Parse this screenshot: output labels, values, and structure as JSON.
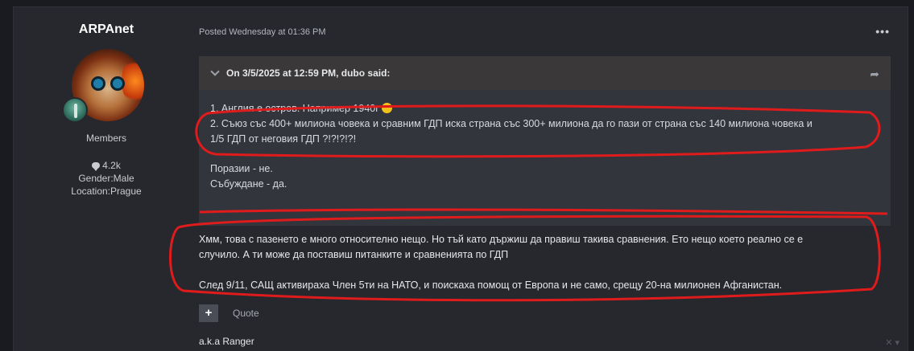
{
  "author": {
    "name": "ARPAnet",
    "group": "Members",
    "post_count": "4.2k",
    "gender": "Gender:Male",
    "location": "Location:Prague"
  },
  "post": {
    "posted": "Posted Wednesday at 01:36 PM",
    "more_label": "•••",
    "quote": {
      "header": "On 3/5/2025 at 12:59 PM, dubo said:",
      "lines": [
        "1. Англия е остров. Например 1940г",
        "2. Съюз със 400+ милиона човека и сравним ГДП иска страна със 300+ милиона да го пази от страна със 140 милиона човека и",
        "1/5 ГДП от неговия ГДП  ?!?!?!?!",
        "Поразии - не.",
        "Събуждане - да."
      ]
    },
    "reply": {
      "lines": [
        "Хмм, това с пазенето е много относително нещо. Но тъй като държиш да правиш такива сравнения. Ето нещо което реално се е",
        "случило. А ти може да поставиш питанките и сравненията по ГДП",
        "След 9/11, САЩ активираха Член 5ти на НАТО, и поискаха помощ от Европа и не само, срещу 20-на милионен Афганистан."
      ]
    },
    "actions": {
      "plus_label": "+",
      "quote_label": "Quote"
    },
    "signature": "a.k.a Ranger"
  },
  "colors": {
    "background": "#1a1b20",
    "panel": "#26282e",
    "quote_bg": "#33353c",
    "annotation_red": "#e01b1b"
  },
  "icons": [
    "comment-icon",
    "chevron-down-icon",
    "share-icon",
    "more-icon",
    "close-icon"
  ]
}
